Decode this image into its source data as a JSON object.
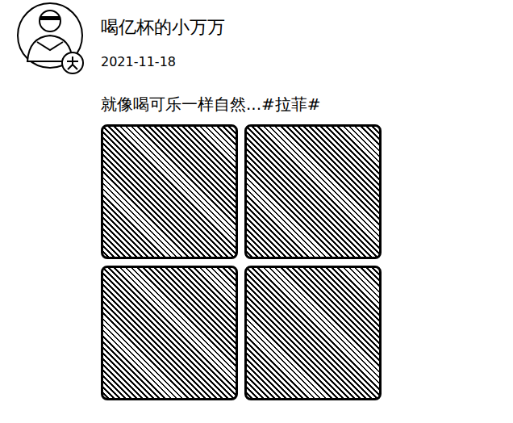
{
  "post": {
    "author": "喝亿杯的小万万",
    "date": "2021-11-18",
    "text": "就像喝可乐一样自然...#拉菲#"
  }
}
